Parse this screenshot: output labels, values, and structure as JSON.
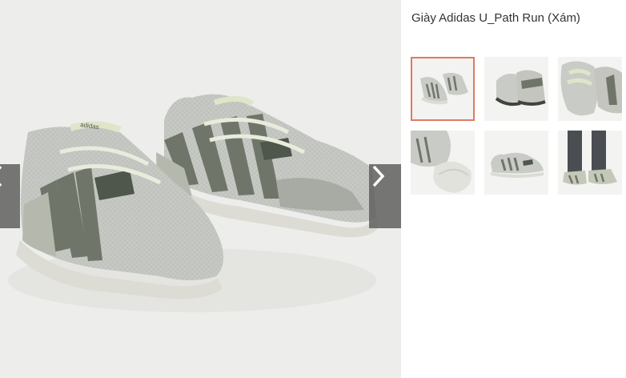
{
  "product": {
    "title": "Giày Adidas U_Path Run (Xám)"
  },
  "viewer": {
    "main_image_icon": "sneaker-pair-photo",
    "prev_icon": "chevron-left-icon",
    "next_icon": "chevron-right-icon",
    "brand_text": "adidas"
  },
  "thumbnails": [
    {
      "icon": "shoe-pair-thumbnail",
      "selected": true
    },
    {
      "icon": "shoe-heel-thumbnail",
      "selected": false
    },
    {
      "icon": "shoe-top-thumbnail",
      "selected": false
    },
    {
      "icon": "shoe-sole-thumbnail",
      "selected": false
    },
    {
      "icon": "shoe-side-thumbnail",
      "selected": false
    },
    {
      "icon": "shoe-worn-thumbnail",
      "selected": false
    }
  ],
  "colors": {
    "accent": "#e07a5f",
    "shoe_grey": "#c9cbc6",
    "stripe": "#6f7569",
    "sole": "#dcdcd4"
  }
}
